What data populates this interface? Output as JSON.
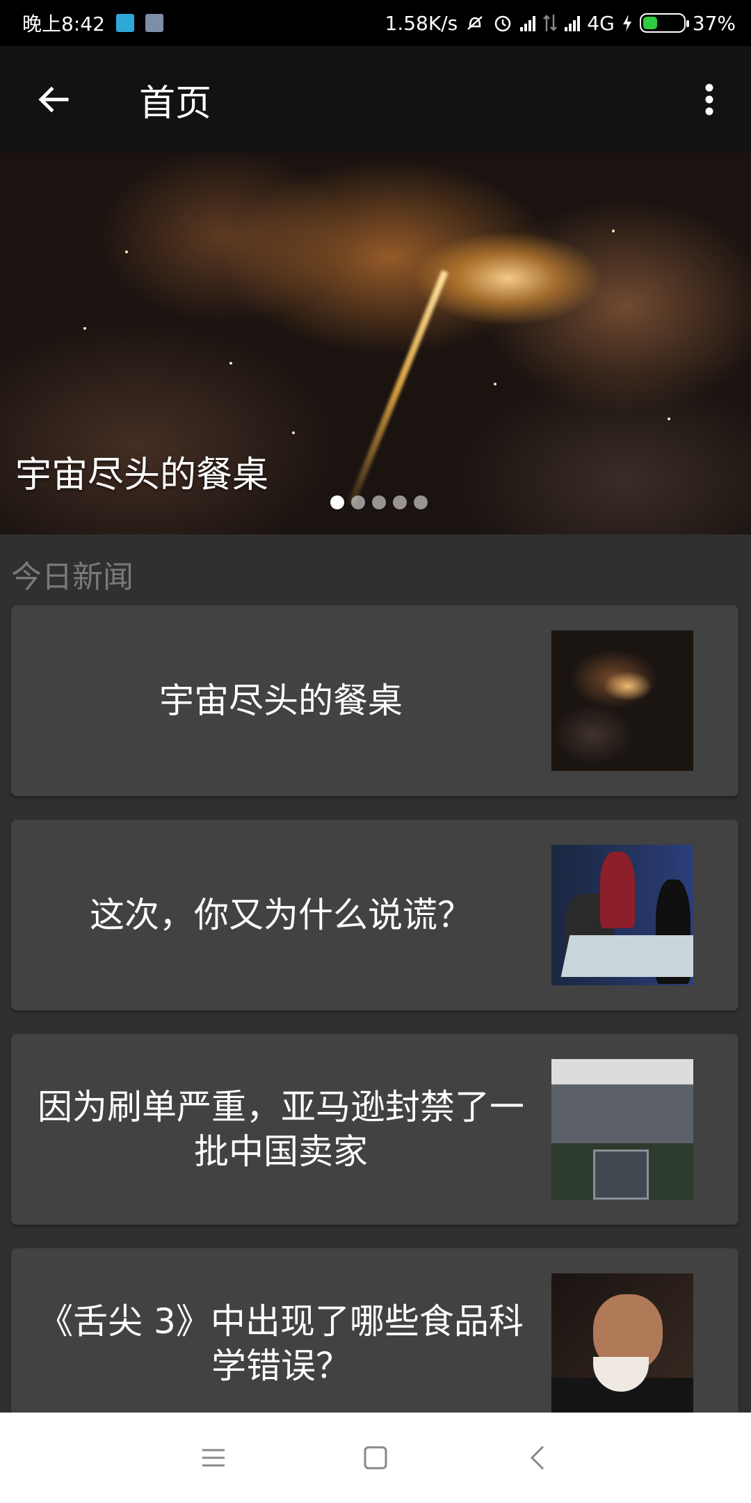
{
  "status_bar": {
    "time": "晚上8:42",
    "net_speed": "1.58K/s",
    "network": "4G",
    "battery_level": 0.37,
    "battery": "37%"
  },
  "app_bar": {
    "title": "首页",
    "back_icon": "arrow-back-icon",
    "more_icon": "more-vert-icon"
  },
  "banner": {
    "caption": "宇宙尽头的餐桌",
    "slide_count": 5,
    "active_slide": 1
  },
  "section": {
    "title": "今日新闻"
  },
  "news": [
    {
      "title": "宇宙尽头的餐桌",
      "thumb": "space-nebula-image"
    },
    {
      "title": "这次，你又为什么说谎？",
      "thumb": "people-meeting-image"
    },
    {
      "title": "因为刷单严重，亚马逊封禁了一批中国卖家",
      "thumb": "amazon-warehouse-image"
    },
    {
      "title": "《舌尖 3》中出现了哪些食品科学错误？",
      "thumb": "man-eating-image"
    }
  ],
  "nav_bar": {
    "menu_icon": "menu-icon",
    "home_icon": "home-square-icon",
    "back_icon": "back-chevron-icon"
  },
  "colors": {
    "background": "#303030",
    "card": "#424242",
    "app_bar": "#121212",
    "battery_fill": "#2ecc40"
  }
}
